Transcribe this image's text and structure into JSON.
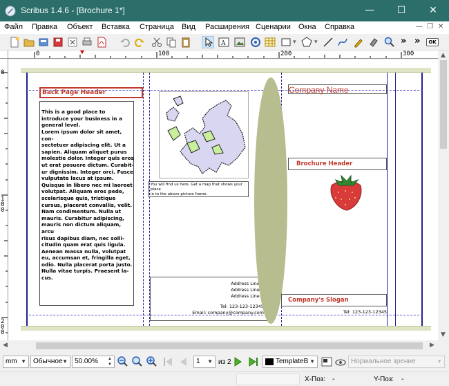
{
  "window": {
    "title": "Scribus 1.4.6 - [Brochure 1*]",
    "minimize_glyph": "—",
    "maximize_glyph": "☐",
    "close_glyph": "✕"
  },
  "menu": {
    "items": [
      "Файл",
      "Правка",
      "Объект",
      "Вставка",
      "Страница",
      "Вид",
      "Расширения",
      "Сценарии",
      "Окна",
      "Справка"
    ],
    "mdi_minimize": "—",
    "mdi_restore": "❐",
    "mdi_close": "✕"
  },
  "toolbar": {
    "more_left": "»",
    "more_right": "»",
    "ok_label": "OK"
  },
  "rulers": {
    "h_labels": [
      "0",
      "100",
      "200",
      "300"
    ],
    "v_labels": [
      "0",
      "100",
      "200"
    ]
  },
  "document": {
    "back_page_header": "Back Page Header",
    "body_paragraph1": "This is a good place to introduce your business in a general level.",
    "body_paragraph2_lines": [
      "Lorem ipsum dolor sit amet, con-",
      "sectetuer adipiscing elit. Ut a",
      "sapien. Aliquam aliquet purus",
      "molestie dolor. Integer quis eros",
      "ut erat posuere dictum. Curabit-",
      "ur dignissim. Integer orci. Fusce",
      "vulputate lacus at ipsum.",
      "Quisque in libero nec mi laoreet",
      "volutpat. Aliquam eros pede,",
      "scelerisque quis, tristique",
      "cursus, placerat convallis, velit.",
      "Nam condimentum. Nulla ut",
      "mauris. Curabitur adipiscing,",
      "mauris non dictum aliquam, arcu",
      "risus dapibus diam, nec solli-",
      "citudin quam erat quis ligula.",
      "Aenean massa nulla, volutpat",
      "eu, accumsan et, fringilla eget,",
      "odio. Nulla placerat porta justo.",
      "Nulla vitae turpis. Praesent la-",
      "cus."
    ],
    "map_caption_lines": [
      "You will find us here. Get a map that shows your place",
      "in to the above picture frame."
    ],
    "address_lines": [
      "Address Line 1",
      "Address Line 2",
      "Address Line 3"
    ],
    "phone": "Tel: 123-123-12345",
    "email": "Email: company@company.com",
    "company_name": "Company Name",
    "brochure_header": "Brochure Header",
    "company_slogan": "Company's Slogan",
    "tel_right": "Tel: 123-123-12345",
    "header_color": "#c0392b",
    "ellipse_color": "#b7bd8e",
    "strawberry_color": "#d93a3a"
  },
  "zoombar": {
    "unit": "mm",
    "mode": "Обычное",
    "zoom": "50.00%",
    "page_current": "1",
    "page_of": "из 2",
    "layer": "TemplateB",
    "view_mode": "Нормальное зрение"
  },
  "statusbar": {
    "x_label": "X-Поз:",
    "x_value": "-",
    "y_label": "Y-Поз:",
    "y_value": "-"
  }
}
